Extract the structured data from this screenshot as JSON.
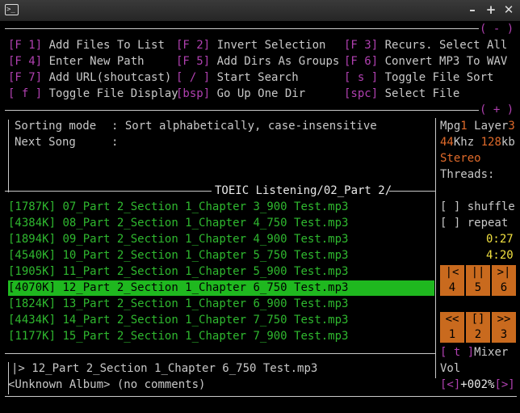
{
  "window": {
    "minimize": "–",
    "maximize": "+",
    "close": "✕"
  },
  "help": {
    "collapse": "( - )",
    "expand": "( + )",
    "rows": [
      [
        {
          "key": "[F 1]",
          "label": "Add Files To List"
        },
        {
          "key": "[F 2]",
          "label": "Invert Selection"
        },
        {
          "key": "[F 3]",
          "label": "Recurs. Select All"
        }
      ],
      [
        {
          "key": "[F 4]",
          "label": "Enter New Path"
        },
        {
          "key": "[F 5]",
          "label": "Add Dirs As Groups"
        },
        {
          "key": "[F 6]",
          "label": "Convert MP3 To WAV"
        }
      ],
      [
        {
          "key": "[F 7]",
          "label": "Add URL(shoutcast)"
        },
        {
          "key": "[ / ]",
          "label": "Start Search"
        },
        {
          "key": "[ s ]",
          "label": "Toggle File Sort"
        }
      ],
      [
        {
          "key": "[ f ]",
          "label": "Toggle File Display"
        },
        {
          "key": "[bsp]",
          "label": "Go Up One Dir"
        },
        {
          "key": "[spc]",
          "label": "Select File"
        }
      ]
    ]
  },
  "info": {
    "sorting_label": "Sorting mode",
    "sorting_value": ": Sort alphabetically, case-insensitive",
    "next_label": "Next Song",
    "next_value": ":"
  },
  "audio": {
    "mpg": "Mpg",
    "mpg_ver": "1",
    "layer": "Layer",
    "layer_ver": "3",
    "khz_val": "44",
    "khz": "Khz",
    "kb_val": "128",
    "kb": "kb",
    "channels": "Stereo",
    "threads": "Threads:"
  },
  "path": "TOEIC Listening/02_Part 2/",
  "playlist": [
    {
      "size": "[1787K]",
      "name": "07_Part 2_Section 1_Chapter 3_900 Test.mp3",
      "selected": false
    },
    {
      "size": "[4384K]",
      "name": "08_Part 2_Section 1_Chapter 4_750 Test.mp3",
      "selected": false
    },
    {
      "size": "[1894K]",
      "name": "09_Part 2_Section 1_Chapter 4_900 Test.mp3",
      "selected": false
    },
    {
      "size": "[4540K]",
      "name": "10_Part 2_Section 1_Chapter 5_750 Test.mp3",
      "selected": false
    },
    {
      "size": "[1905K]",
      "name": "11_Part 2_Section 1_Chapter 5_900 Test.mp3",
      "selected": false
    },
    {
      "size": "[4070K]",
      "name": "12_Part 2_Section 1_Chapter 6_750 Test.mp3",
      "selected": true
    },
    {
      "size": "[1824K]",
      "name": "13_Part 2_Section 1_Chapter 6_900 Test.mp3",
      "selected": false
    },
    {
      "size": "[4434K]",
      "name": "14_Part 2_Section 1_Chapter 7_750 Test.mp3",
      "selected": false
    },
    {
      "size": "[1177K]",
      "name": "15_Part 2_Section 1_Chapter 7_900 Test.mp3",
      "selected": false
    }
  ],
  "controls": {
    "shuffle": "[ ] shuffle",
    "repeat": "[ ] repeat",
    "elapsed": "0:27",
    "total": "4:20",
    "buttons_row1": [
      {
        "sym": "|<",
        "num": "4"
      },
      {
        "sym": "||",
        "num": "5"
      },
      {
        "sym": ">|",
        "num": "6"
      }
    ],
    "buttons_row2": [
      {
        "sym": "<<",
        "num": "1"
      },
      {
        "sym": "[]",
        "num": "2"
      },
      {
        "sym": ">>",
        "num": "3"
      }
    ],
    "mixer_key": "[ t ]",
    "mixer": "Mixer",
    "vol_label": "Vol",
    "vol_left": "[<]",
    "vol_value": "+002%",
    "vol_right": "[>]"
  },
  "now_playing": {
    "prefix": "|>",
    "title": "12_Part 2_Section 1_Chapter 6_750 Test.mp3",
    "album": "<Unknown Album>",
    "comments": "(no comments)"
  }
}
